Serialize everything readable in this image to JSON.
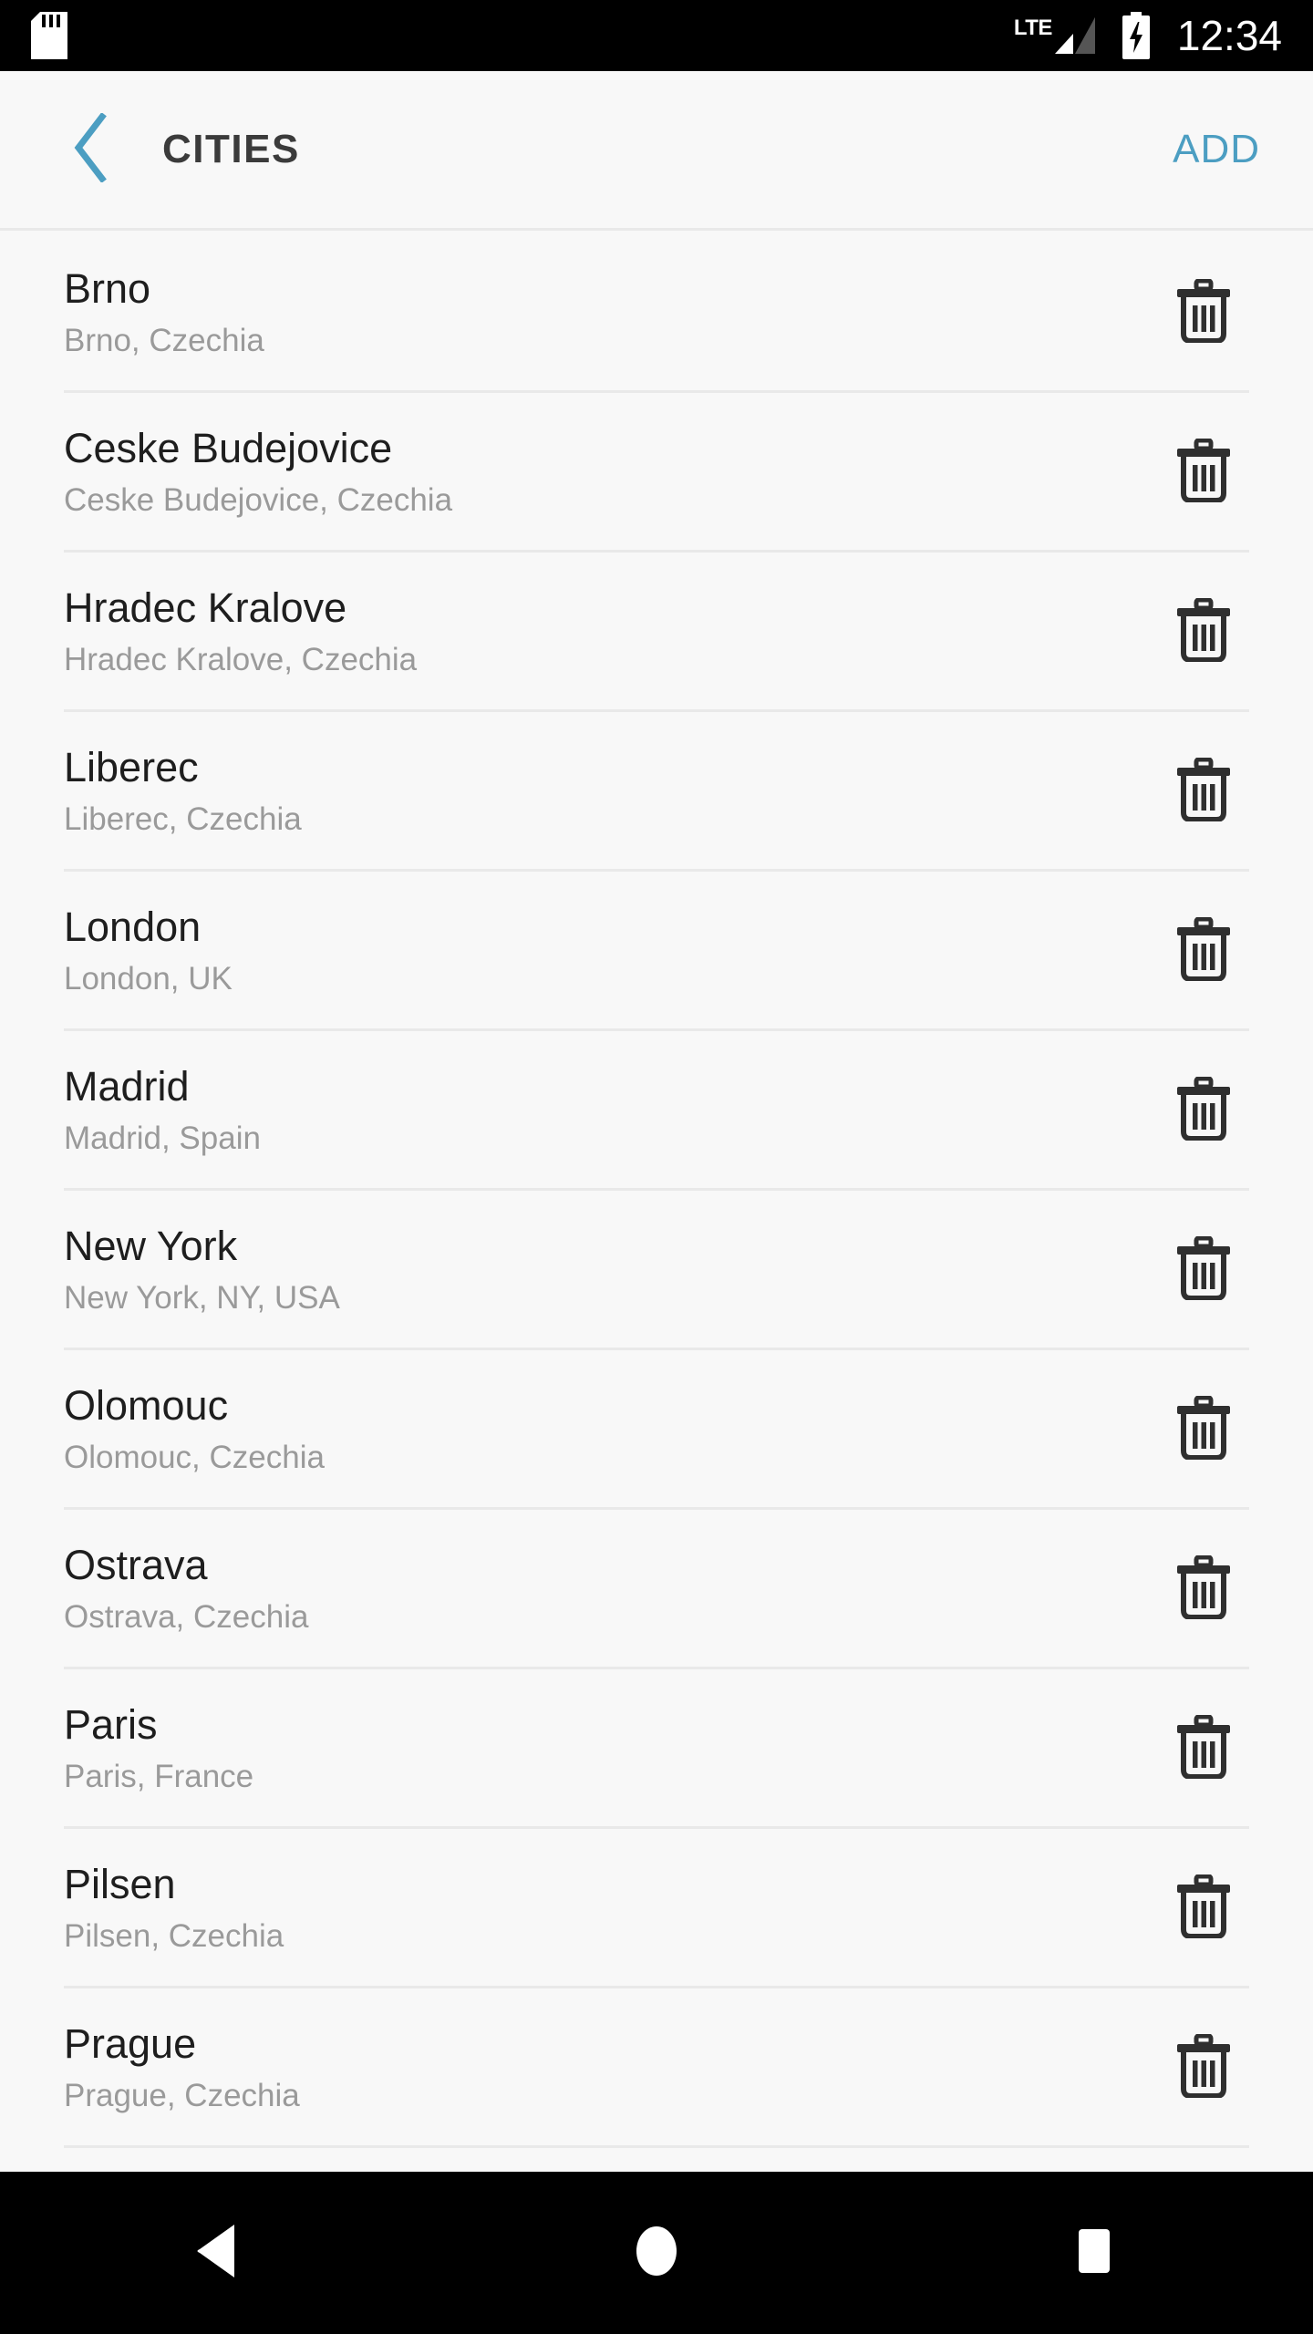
{
  "status_bar": {
    "sim_icon": "sim-card-icon",
    "network_label": "LTE",
    "signal_icon": "signal-bars-icon",
    "battery_icon": "battery-charging-icon",
    "time": "12:34",
    "background": "#000000",
    "foreground": "#ffffff"
  },
  "app_bar": {
    "back_icon": "chevron-left-icon",
    "title": "CITIES",
    "action_label": "ADD",
    "accent_color": "#4c9ec2",
    "title_color": "#3b3b3b",
    "background": "#f8f8f8"
  },
  "list": {
    "delete_icon": "trash-icon",
    "divider_color": "#e9e9e9",
    "title_color": "#1e1e1e",
    "subtitle_color": "#9a9a9a",
    "items": [
      {
        "title": "Brno",
        "subtitle": "Brno, Czechia"
      },
      {
        "title": "Ceske Budejovice",
        "subtitle": "Ceske Budejovice, Czechia"
      },
      {
        "title": "Hradec Kralove",
        "subtitle": "Hradec Kralove, Czechia"
      },
      {
        "title": "Liberec",
        "subtitle": "Liberec, Czechia"
      },
      {
        "title": "London",
        "subtitle": "London, UK"
      },
      {
        "title": "Madrid",
        "subtitle": "Madrid, Spain"
      },
      {
        "title": "New York",
        "subtitle": "New York, NY, USA"
      },
      {
        "title": "Olomouc",
        "subtitle": "Olomouc, Czechia"
      },
      {
        "title": "Ostrava",
        "subtitle": "Ostrava, Czechia"
      },
      {
        "title": "Paris",
        "subtitle": "Paris, France"
      },
      {
        "title": "Pilsen",
        "subtitle": "Pilsen, Czechia"
      },
      {
        "title": "Prague",
        "subtitle": "Prague, Czechia"
      }
    ]
  },
  "nav_bar": {
    "background": "#000000",
    "buttons": [
      {
        "name": "nav-back-button",
        "icon": "triangle-left-icon"
      },
      {
        "name": "nav-home-button",
        "icon": "circle-icon"
      },
      {
        "name": "nav-recents-button",
        "icon": "square-icon"
      }
    ]
  }
}
